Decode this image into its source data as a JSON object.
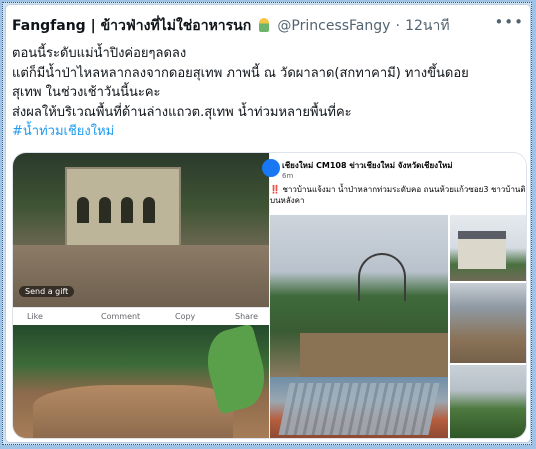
{
  "tweet": {
    "display_name": "Fangfang | ข้าวฟ่างที่ไม่ใช่อาหารนก",
    "handle": "@PrincessFangy",
    "separator": "·",
    "time": "12นาที",
    "more_icon": "more-horizontal-icon",
    "lines": [
      "ตอนนี้ระดับแม่น้ำปิงค่อยๆลดลง",
      "แต่ก็มีน้ำป่าไหลหลากลงจากดอยสุเทพ ภาพนี้ ณ วัดผาลาด(สกทาคามี) ทางขึ้นดอย",
      "สุเทพ ในช่วงเช้าวันนี้นะคะ",
      "ส่งผลให้บริเวณพื้นที่ด้านล่างแถวต.สุเทพ น้ำท่วมหลายพื้นที่คะ"
    ],
    "hashtag": "#น้ำท่วมเชียงใหม่",
    "hashtag_color": "#1d9bf0"
  },
  "media": {
    "left_top": {
      "gift_label": "Send a gift",
      "actions": [
        "Like",
        "Comment",
        "Copy",
        "Share"
      ]
    },
    "fb_post": {
      "page_name": "เชียงใหม่ CM108 ข่าวเชียงใหม่ จังหวัดเชียงใหม่",
      "time": "6m",
      "body_lines": [
        "‼️ ชาวบ้านแจ้งมา น้ำป่าหลากท่วมระดับคอ ถนนห้วยแก้วซอย3 ชาวบ้านติดอยู่",
        "บนหลังคา"
      ]
    }
  },
  "colors": {
    "text": "#0f1419",
    "secondary": "#536471",
    "page_background": "#9fc3e6"
  }
}
